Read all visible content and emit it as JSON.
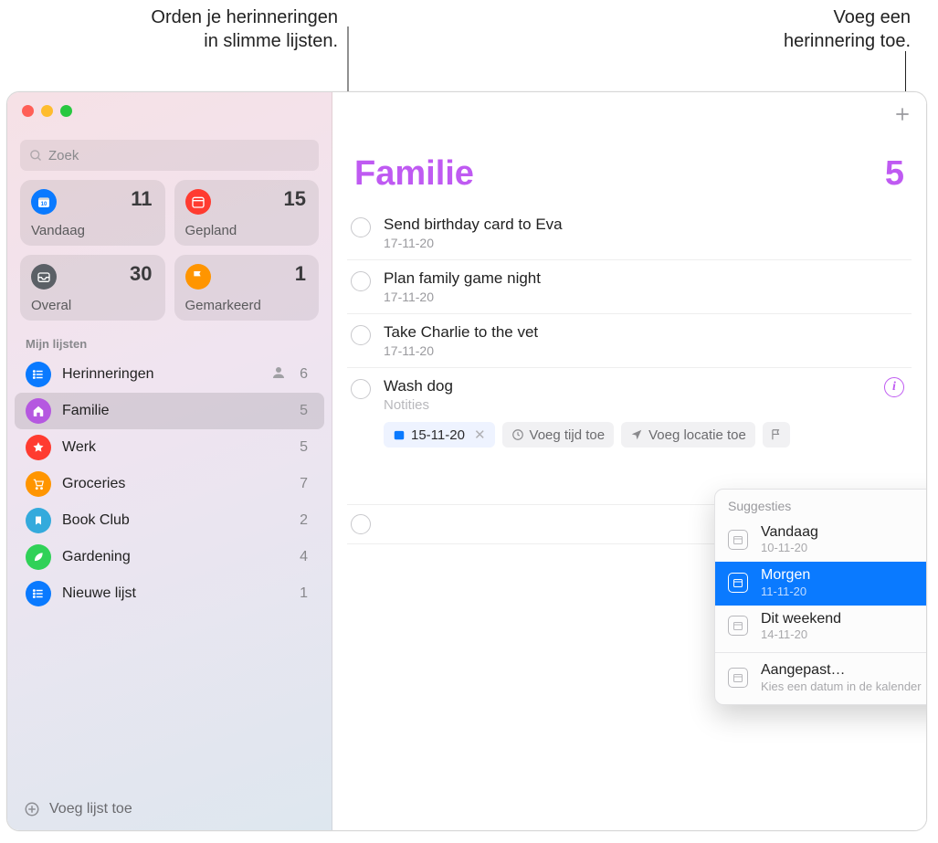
{
  "callouts": {
    "left_line1": "Orden je herinneringen",
    "left_line2": "in slimme lijsten.",
    "right_line1": "Voeg een",
    "right_line2": "herinnering toe."
  },
  "search": {
    "placeholder": "Zoek"
  },
  "smart_lists": [
    {
      "label": "Vandaag",
      "count": "11",
      "color": "bg-blue",
      "icon": "calendar"
    },
    {
      "label": "Gepland",
      "count": "15",
      "color": "bg-red",
      "icon": "calendar"
    },
    {
      "label": "Overal",
      "count": "30",
      "color": "bg-grey",
      "icon": "tray"
    },
    {
      "label": "Gemarkeerd",
      "count": "1",
      "color": "bg-orange",
      "icon": "flag"
    }
  ],
  "my_lists_header": "Mijn lijsten",
  "lists": [
    {
      "name": "Herinneringen",
      "count": "6",
      "color": "bg-bluel",
      "shared": true
    },
    {
      "name": "Familie",
      "count": "5",
      "color": "bg-purple",
      "selected": true
    },
    {
      "name": "Werk",
      "count": "5",
      "color": "bg-red2"
    },
    {
      "name": "Groceries",
      "count": "7",
      "color": "bg-orange2"
    },
    {
      "name": "Book Club",
      "count": "2",
      "color": "bg-cyan"
    },
    {
      "name": "Gardening",
      "count": "4",
      "color": "bg-green"
    },
    {
      "name": "Nieuwe lijst",
      "count": "1",
      "color": "bg-bluel"
    }
  ],
  "add_list_label": "Voeg lijst toe",
  "main": {
    "title": "Familie",
    "count": "5",
    "accent": "#bf5af2"
  },
  "reminders": [
    {
      "title": "Send birthday card to Eva",
      "date": "17-11-20"
    },
    {
      "title": "Plan family game night",
      "date": "17-11-20"
    },
    {
      "title": "Take Charlie to the vet",
      "date": "17-11-20"
    }
  ],
  "editing": {
    "title": "Wash dog",
    "notes_placeholder": "Notities",
    "date_chip": "15-11-20",
    "time_chip": "Voeg tijd toe",
    "location_chip": "Voeg locatie toe"
  },
  "popover": {
    "header": "Suggesties",
    "items": [
      {
        "label": "Vandaag",
        "date": "10-11-20"
      },
      {
        "label": "Morgen",
        "date": "11-11-20",
        "selected": true
      },
      {
        "label": "Dit weekend",
        "date": "14-11-20"
      }
    ],
    "custom_label": "Aangepast…",
    "custom_sub": "Kies een datum in de kalender"
  }
}
